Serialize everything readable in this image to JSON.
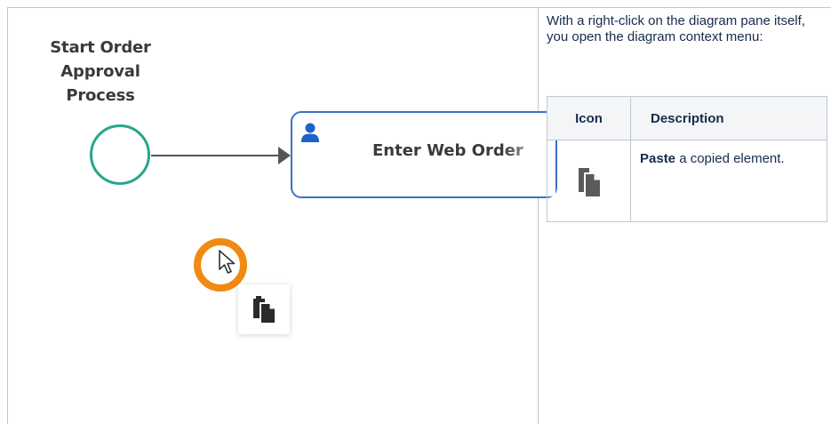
{
  "diagram": {
    "start_event_label": "Start Order\nApproval Process",
    "task_label": "Enter Web Order",
    "colors": {
      "start_event": "#26a68a",
      "task_border": "#3a72c7",
      "cursor_ring": "#f08a12",
      "flow": "#555555"
    },
    "context_menu": {
      "items": [
        {
          "icon": "paste-icon"
        }
      ]
    }
  },
  "panel": {
    "intro": "With a right-click on the diagram pane itself, you open the diagram context menu:",
    "table": {
      "headers": [
        "Icon",
        "Description"
      ],
      "rows": [
        {
          "icon": "paste-icon",
          "label_bold": "Paste",
          "label_rest": " a copied element."
        }
      ]
    }
  }
}
